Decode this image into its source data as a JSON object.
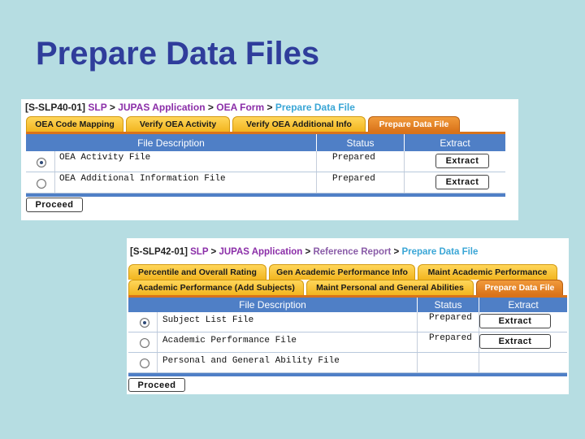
{
  "slide_title": "Prepare Data Files",
  "panel1": {
    "breadcrumb": {
      "code": "[S-SLP40-01]",
      "slp": "SLP",
      "sep": ">",
      "jupas": "JUPAS Application",
      "oea": "OEA Form",
      "current": "Prepare Data File"
    },
    "tabs": [
      "OEA Code Mapping",
      "Verify OEA Activity",
      "Verify OEA Additional Info",
      "Prepare Data File"
    ],
    "headers": {
      "file_description": "File Description",
      "status": "Status",
      "extract": "Extract"
    },
    "rows": [
      {
        "file": "OEA Activity File",
        "status": "Prepared",
        "extract": "Extract",
        "selected": true
      },
      {
        "file": "OEA Additional Information File",
        "status": "Prepared",
        "extract": "Extract",
        "selected": false
      }
    ],
    "proceed": "Proceed"
  },
  "panel2": {
    "breadcrumb": {
      "code": "[S-SLP42-01]",
      "slp": "SLP",
      "sep": ">",
      "jupas": "JUPAS Application",
      "report": "Reference Report",
      "current": "Prepare Data File"
    },
    "tabs_row1": [
      "Percentile and Overall Rating",
      "Gen Academic Performance Info",
      "Maint Academic Performance"
    ],
    "tabs_row2": [
      "Academic Performance (Add Subjects)",
      "Maint Personal and General Abilities",
      "Prepare Data File"
    ],
    "headers": {
      "file_description": "File Description",
      "status": "Status",
      "extract": "Extract"
    },
    "rows": [
      {
        "file": "Subject List File",
        "status": "Prepared",
        "extract": "Extract",
        "selected": true
      },
      {
        "file": "Academic Performance File",
        "status": "Prepared",
        "extract": "Extract",
        "selected": false
      },
      {
        "file": "Personal and General Ability File",
        "status": "",
        "extract": "",
        "selected": false
      }
    ],
    "proceed": "Proceed"
  }
}
